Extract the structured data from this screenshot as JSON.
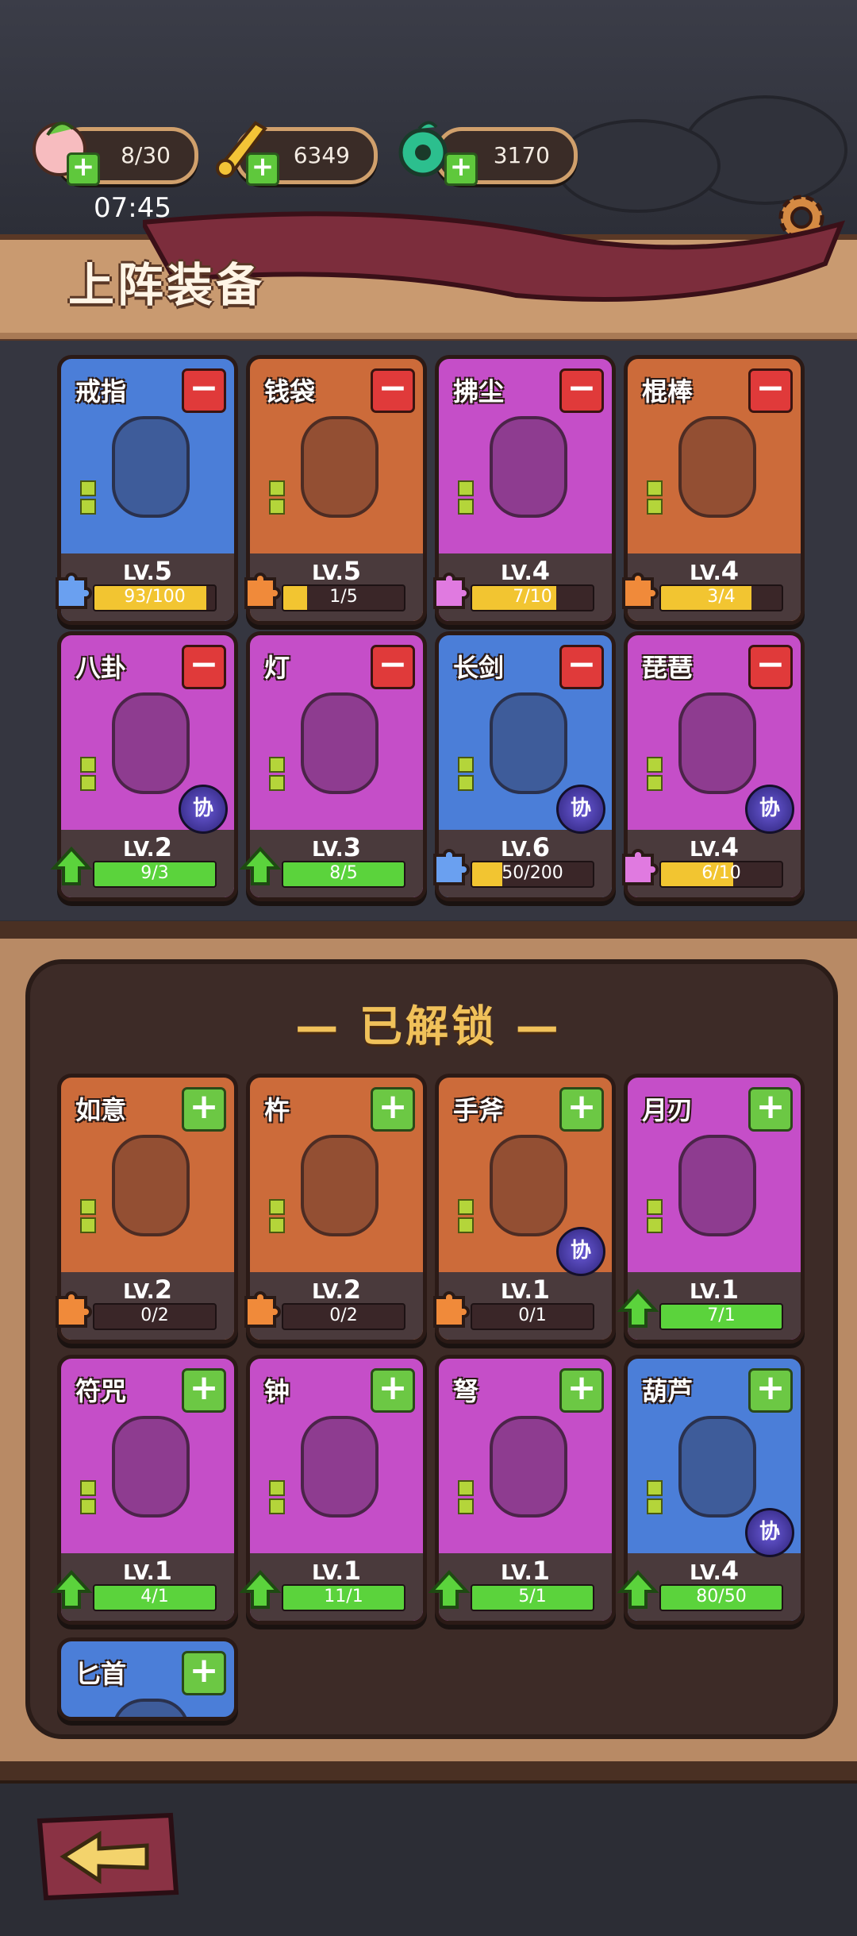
{
  "resources": [
    {
      "name": "stamina",
      "value": "8/30"
    },
    {
      "name": "gold",
      "value": "6349"
    },
    {
      "name": "jade",
      "value": "3170"
    }
  ],
  "clock": "07:45",
  "banner_title": "上阵装备",
  "unlocked_title": "— 已解锁 —",
  "equipped": [
    {
      "name": "戒指",
      "lv_prefix": "LV.",
      "lv": "5",
      "progress": "93/100",
      "fill": 0.93,
      "color": "blue",
      "action": "−"
    },
    {
      "name": "钱袋",
      "lv_prefix": "LV.",
      "lv": "5",
      "progress": "1/5",
      "fill": 0.2,
      "color": "orange",
      "action": "−"
    },
    {
      "name": "拂尘",
      "lv_prefix": "LV.",
      "lv": "4",
      "progress": "7/10",
      "fill": 0.7,
      "color": "purple",
      "action": "−"
    },
    {
      "name": "棍棒",
      "lv_prefix": "LV.",
      "lv": "4",
      "progress": "3/4",
      "fill": 0.75,
      "color": "orange",
      "action": "−"
    },
    {
      "name": "八卦",
      "lv_prefix": "LV.",
      "lv": "2",
      "progress": "9/3",
      "fill": 1.0,
      "color": "purple",
      "action": "−",
      "badge": "协"
    },
    {
      "name": "灯",
      "lv_prefix": "LV.",
      "lv": "3",
      "progress": "8/5",
      "fill": 1.0,
      "color": "purple",
      "action": "−"
    },
    {
      "name": "长剑",
      "lv_prefix": "LV.",
      "lv": "6",
      "progress": "50/200",
      "fill": 0.25,
      "color": "blue",
      "action": "−",
      "badge": "协"
    },
    {
      "name": "琵琶",
      "lv_prefix": "LV.",
      "lv": "4",
      "progress": "6/10",
      "fill": 0.6,
      "color": "purple",
      "action": "−",
      "badge": "协"
    }
  ],
  "unlocked": [
    {
      "name": "如意",
      "lv_prefix": "LV.",
      "lv": "2",
      "progress": "0/2",
      "fill": 0,
      "color": "orange",
      "action": "+"
    },
    {
      "name": "杵",
      "lv_prefix": "LV.",
      "lv": "2",
      "progress": "0/2",
      "fill": 0,
      "color": "orange",
      "action": "+"
    },
    {
      "name": "手斧",
      "lv_prefix": "LV.",
      "lv": "1",
      "progress": "0/1",
      "fill": 0,
      "color": "orange",
      "action": "+",
      "badge": "协"
    },
    {
      "name": "月刃",
      "lv_prefix": "LV.",
      "lv": "1",
      "progress": "7/1",
      "fill": 1.0,
      "color": "purple",
      "action": "+"
    },
    {
      "name": "符咒",
      "lv_prefix": "LV.",
      "lv": "1",
      "progress": "4/1",
      "fill": 1.0,
      "color": "purple",
      "action": "+"
    },
    {
      "name": "钟",
      "lv_prefix": "LV.",
      "lv": "1",
      "progress": "11/1",
      "fill": 1.0,
      "color": "purple",
      "action": "+"
    },
    {
      "name": "弩",
      "lv_prefix": "LV.",
      "lv": "1",
      "progress": "5/1",
      "fill": 1.0,
      "color": "purple",
      "action": "+"
    },
    {
      "name": "葫芦",
      "lv_prefix": "LV.",
      "lv": "4",
      "progress": "80/50",
      "fill": 1.0,
      "color": "blue",
      "action": "+",
      "badge": "协"
    },
    {
      "name": "匕首",
      "color": "blue",
      "action": "+"
    }
  ],
  "colors": {
    "blue": "#4b7ed8",
    "orange": "#cc6b3a",
    "purple": "#c54ec8",
    "bar_yellow": "#f2c531",
    "bar_green": "#5bd33c"
  }
}
